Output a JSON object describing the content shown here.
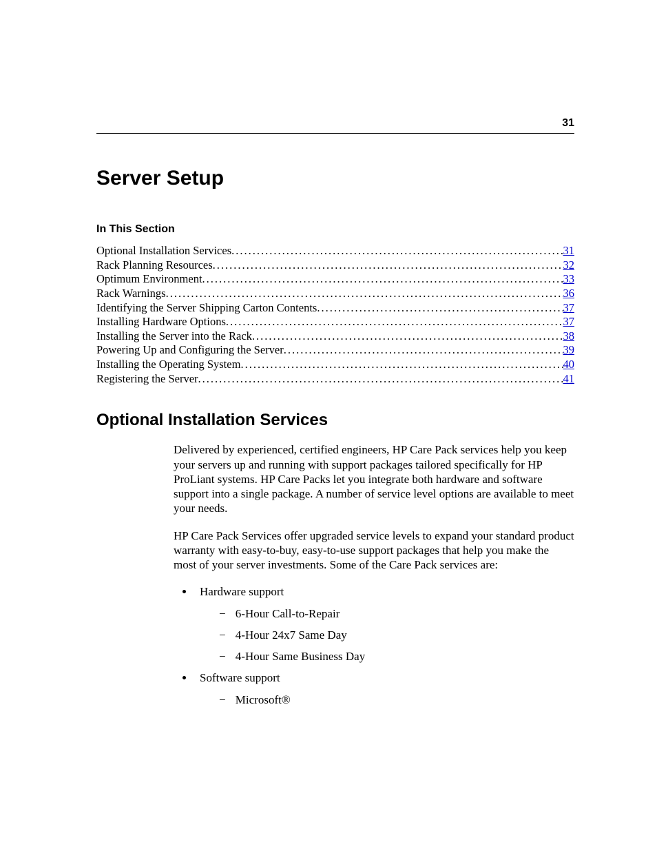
{
  "page_number": "31",
  "chapter_title": "Server Setup",
  "section_label": "In This Section",
  "toc": [
    {
      "label": "Optional Installation Services",
      "page": "31"
    },
    {
      "label": "Rack Planning Resources",
      "page": "32"
    },
    {
      "label": "Optimum Environment",
      "page": "33"
    },
    {
      "label": "Rack Warnings",
      "page": "36"
    },
    {
      "label": "Identifying the Server Shipping Carton Contents",
      "page": "37"
    },
    {
      "label": "Installing Hardware Options",
      "page": "37"
    },
    {
      "label": "Installing the Server into the Rack",
      "page": "38"
    },
    {
      "label": "Powering Up and Configuring the Server",
      "page": "39"
    },
    {
      "label": "Installing the Operating System",
      "page": "40"
    },
    {
      "label": "Registering the Server",
      "page": "41"
    }
  ],
  "section_title": "Optional Installation Services",
  "body": {
    "p1": "Delivered by experienced, certified engineers, HP Care Pack services help you keep your servers up and running with support packages tailored specifically for HP ProLiant systems. HP Care Packs let you integrate both hardware and software support into a single package. A number of service level options are available to meet your needs.",
    "p2": "HP Care Pack Services offer upgraded service levels to expand your standard product warranty with easy-to-buy, easy-to-use support packages that help you make the most of your server investments. Some of the Care Pack services are:",
    "bullets": [
      {
        "text": "Hardware support",
        "sub": [
          "6-Hour Call-to-Repair",
          "4-Hour 24x7 Same Day",
          "4-Hour Same Business Day"
        ]
      },
      {
        "text": "Software support",
        "sub": [
          "Microsoft®"
        ]
      }
    ]
  }
}
